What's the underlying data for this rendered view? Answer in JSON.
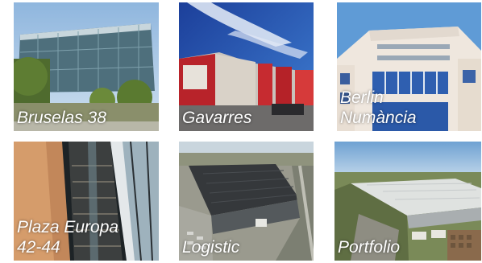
{
  "gallery": {
    "items": [
      {
        "caption": "Bruselas 38"
      },
      {
        "caption": "Gavarres"
      },
      {
        "caption": "Berlin\nNumància"
      },
      {
        "caption": "Plaza Europa\n42-44"
      },
      {
        "caption": "Logistic"
      },
      {
        "caption": "Portfolio"
      }
    ]
  }
}
